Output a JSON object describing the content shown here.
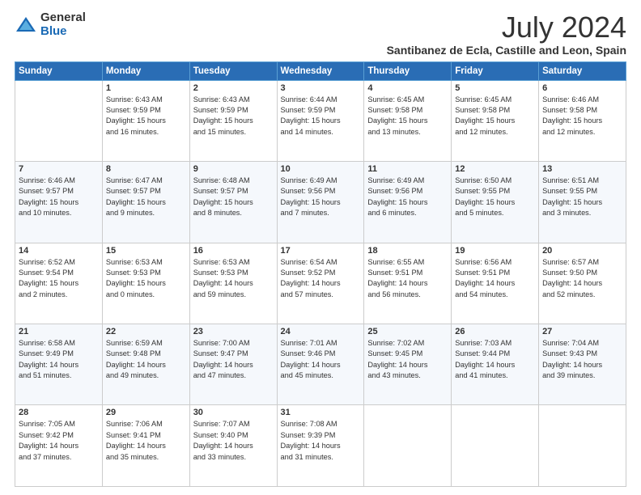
{
  "header": {
    "logo_general": "General",
    "logo_blue": "Blue",
    "month_title": "July 2024",
    "location": "Santibanez de Ecla, Castille and Leon, Spain"
  },
  "weekdays": [
    "Sunday",
    "Monday",
    "Tuesday",
    "Wednesday",
    "Thursday",
    "Friday",
    "Saturday"
  ],
  "weeks": [
    [
      {
        "day": "",
        "info": ""
      },
      {
        "day": "1",
        "info": "Sunrise: 6:43 AM\nSunset: 9:59 PM\nDaylight: 15 hours\nand 16 minutes."
      },
      {
        "day": "2",
        "info": "Sunrise: 6:43 AM\nSunset: 9:59 PM\nDaylight: 15 hours\nand 15 minutes."
      },
      {
        "day": "3",
        "info": "Sunrise: 6:44 AM\nSunset: 9:59 PM\nDaylight: 15 hours\nand 14 minutes."
      },
      {
        "day": "4",
        "info": "Sunrise: 6:45 AM\nSunset: 9:58 PM\nDaylight: 15 hours\nand 13 minutes."
      },
      {
        "day": "5",
        "info": "Sunrise: 6:45 AM\nSunset: 9:58 PM\nDaylight: 15 hours\nand 12 minutes."
      },
      {
        "day": "6",
        "info": "Sunrise: 6:46 AM\nSunset: 9:58 PM\nDaylight: 15 hours\nand 12 minutes."
      }
    ],
    [
      {
        "day": "7",
        "info": "Sunrise: 6:46 AM\nSunset: 9:57 PM\nDaylight: 15 hours\nand 10 minutes."
      },
      {
        "day": "8",
        "info": "Sunrise: 6:47 AM\nSunset: 9:57 PM\nDaylight: 15 hours\nand 9 minutes."
      },
      {
        "day": "9",
        "info": "Sunrise: 6:48 AM\nSunset: 9:57 PM\nDaylight: 15 hours\nand 8 minutes."
      },
      {
        "day": "10",
        "info": "Sunrise: 6:49 AM\nSunset: 9:56 PM\nDaylight: 15 hours\nand 7 minutes."
      },
      {
        "day": "11",
        "info": "Sunrise: 6:49 AM\nSunset: 9:56 PM\nDaylight: 15 hours\nand 6 minutes."
      },
      {
        "day": "12",
        "info": "Sunrise: 6:50 AM\nSunset: 9:55 PM\nDaylight: 15 hours\nand 5 minutes."
      },
      {
        "day": "13",
        "info": "Sunrise: 6:51 AM\nSunset: 9:55 PM\nDaylight: 15 hours\nand 3 minutes."
      }
    ],
    [
      {
        "day": "14",
        "info": "Sunrise: 6:52 AM\nSunset: 9:54 PM\nDaylight: 15 hours\nand 2 minutes."
      },
      {
        "day": "15",
        "info": "Sunrise: 6:53 AM\nSunset: 9:53 PM\nDaylight: 15 hours\nand 0 minutes."
      },
      {
        "day": "16",
        "info": "Sunrise: 6:53 AM\nSunset: 9:53 PM\nDaylight: 14 hours\nand 59 minutes."
      },
      {
        "day": "17",
        "info": "Sunrise: 6:54 AM\nSunset: 9:52 PM\nDaylight: 14 hours\nand 57 minutes."
      },
      {
        "day": "18",
        "info": "Sunrise: 6:55 AM\nSunset: 9:51 PM\nDaylight: 14 hours\nand 56 minutes."
      },
      {
        "day": "19",
        "info": "Sunrise: 6:56 AM\nSunset: 9:51 PM\nDaylight: 14 hours\nand 54 minutes."
      },
      {
        "day": "20",
        "info": "Sunrise: 6:57 AM\nSunset: 9:50 PM\nDaylight: 14 hours\nand 52 minutes."
      }
    ],
    [
      {
        "day": "21",
        "info": "Sunrise: 6:58 AM\nSunset: 9:49 PM\nDaylight: 14 hours\nand 51 minutes."
      },
      {
        "day": "22",
        "info": "Sunrise: 6:59 AM\nSunset: 9:48 PM\nDaylight: 14 hours\nand 49 minutes."
      },
      {
        "day": "23",
        "info": "Sunrise: 7:00 AM\nSunset: 9:47 PM\nDaylight: 14 hours\nand 47 minutes."
      },
      {
        "day": "24",
        "info": "Sunrise: 7:01 AM\nSunset: 9:46 PM\nDaylight: 14 hours\nand 45 minutes."
      },
      {
        "day": "25",
        "info": "Sunrise: 7:02 AM\nSunset: 9:45 PM\nDaylight: 14 hours\nand 43 minutes."
      },
      {
        "day": "26",
        "info": "Sunrise: 7:03 AM\nSunset: 9:44 PM\nDaylight: 14 hours\nand 41 minutes."
      },
      {
        "day": "27",
        "info": "Sunrise: 7:04 AM\nSunset: 9:43 PM\nDaylight: 14 hours\nand 39 minutes."
      }
    ],
    [
      {
        "day": "28",
        "info": "Sunrise: 7:05 AM\nSunset: 9:42 PM\nDaylight: 14 hours\nand 37 minutes."
      },
      {
        "day": "29",
        "info": "Sunrise: 7:06 AM\nSunset: 9:41 PM\nDaylight: 14 hours\nand 35 minutes."
      },
      {
        "day": "30",
        "info": "Sunrise: 7:07 AM\nSunset: 9:40 PM\nDaylight: 14 hours\nand 33 minutes."
      },
      {
        "day": "31",
        "info": "Sunrise: 7:08 AM\nSunset: 9:39 PM\nDaylight: 14 hours\nand 31 minutes."
      },
      {
        "day": "",
        "info": ""
      },
      {
        "day": "",
        "info": ""
      },
      {
        "day": "",
        "info": ""
      }
    ]
  ]
}
